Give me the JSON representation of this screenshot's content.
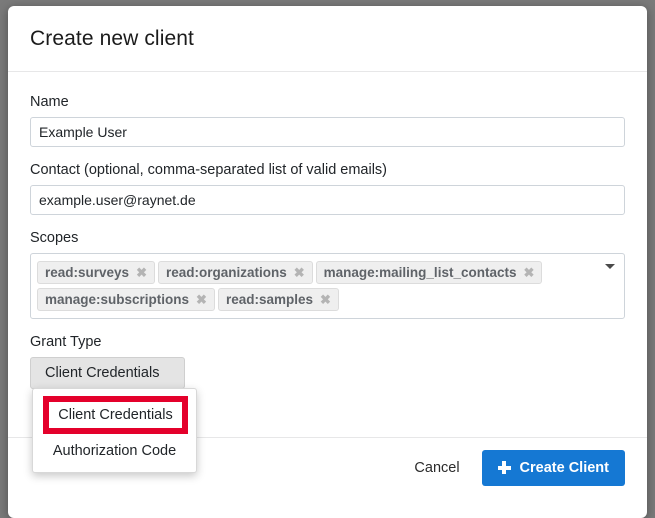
{
  "dialog": {
    "title": "Create new client"
  },
  "fields": {
    "name": {
      "label": "Name",
      "value": "Example User",
      "placeholder": "Name"
    },
    "contact": {
      "label": "Contact (optional, comma-separated list of valid emails)",
      "value": "example.user@raynet.de",
      "placeholder": "Contact"
    },
    "scopes": {
      "label": "Scopes",
      "caret_icon": "chevron-down-icon",
      "remove_icon": "close-icon",
      "tags": [
        "read:surveys",
        "read:organizations",
        "manage:mailing_list_contacts",
        "manage:subscriptions",
        "read:samples"
      ]
    },
    "grant_type": {
      "label": "Grant Type",
      "selected": "Client Credentials",
      "options": [
        "Client Credentials",
        "Authorization Code"
      ],
      "highlighted_option": "Client Credentials",
      "highlight_color": "#e4002b"
    }
  },
  "footer": {
    "cancel_label": "Cancel",
    "create_label": "Create Client",
    "create_icon": "plus-icon",
    "primary_color": "#1578d3"
  }
}
